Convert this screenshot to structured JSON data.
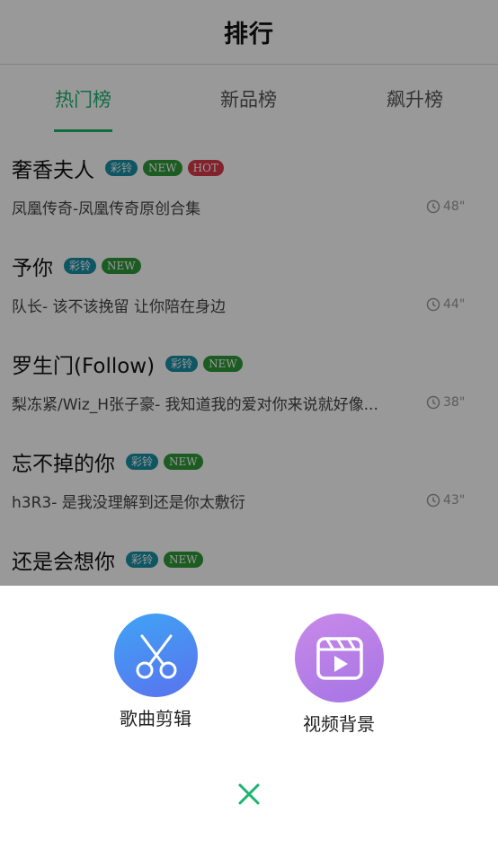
{
  "header": {
    "title": "排行"
  },
  "tabs": [
    {
      "label": "热门榜",
      "active": true
    },
    {
      "label": "新品榜",
      "active": false
    },
    {
      "label": "飙升榜",
      "active": false
    }
  ],
  "songs": [
    {
      "title": "奢香夫人",
      "badges": [
        "彩铃",
        "NEW",
        "HOT"
      ],
      "subtitle": "凤凰传奇-凤凰传奇原创合集",
      "duration": "48\""
    },
    {
      "title": "予你",
      "badges": [
        "彩铃",
        "NEW"
      ],
      "subtitle": "队长-  该不该挽留 让你陪在身边",
      "duration": "44\""
    },
    {
      "title": "罗生门(Follow)",
      "badges": [
        "彩铃",
        "NEW"
      ],
      "subtitle": "梨冻紧/Wiz_H张子豪-  我知道我的爱对你来说就好像...",
      "duration": "38\""
    },
    {
      "title": "忘不掉的你",
      "badges": [
        "彩铃",
        "NEW"
      ],
      "subtitle": "h3R3- 是我没理解到还是你太敷衍",
      "duration": "43\""
    },
    {
      "title": "还是会想你",
      "badges": [
        "彩铃",
        "NEW"
      ],
      "subtitle": "",
      "duration": ""
    }
  ],
  "sheet": {
    "actions": [
      {
        "label": "歌曲剪辑",
        "icon": "scissors-icon",
        "color": "#4a7ff0"
      },
      {
        "label": "视频背景",
        "icon": "video-play-icon",
        "color": "#b57be6"
      }
    ],
    "close_icon": "close-icon",
    "accent": "#1db46e"
  }
}
